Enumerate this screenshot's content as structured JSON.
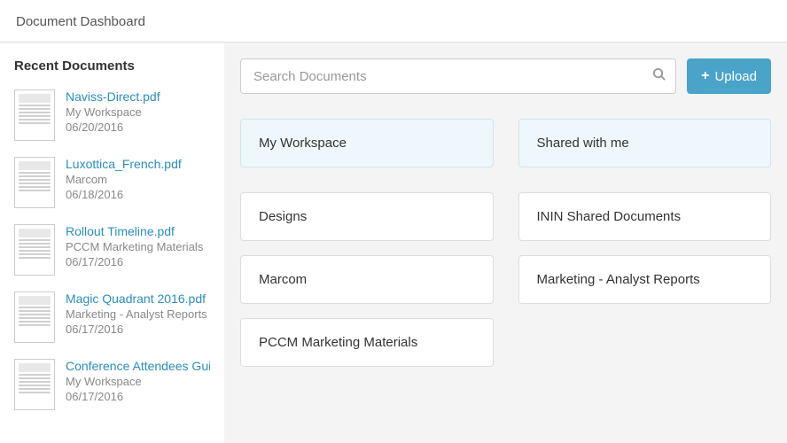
{
  "header": {
    "title": "Document Dashboard"
  },
  "sidebar": {
    "title": "Recent Documents",
    "docs": [
      {
        "title": "Naviss-Direct.pdf",
        "workspace": "My Workspace",
        "date": "06/20/2016"
      },
      {
        "title": "Luxottica_French.pdf",
        "workspace": "Marcom",
        "date": "06/18/2016"
      },
      {
        "title": "Rollout Timeline.pdf",
        "workspace": "PCCM Marketing Materials",
        "date": "06/17/2016"
      },
      {
        "title": "Magic Quadrant 2016.pdf",
        "workspace": "Marketing - Analyst Reports",
        "date": "06/17/2016"
      },
      {
        "title": "Conference Attendees Guide",
        "workspace": "My Workspace",
        "date": "06/17/2016"
      }
    ]
  },
  "search": {
    "placeholder": "Search Documents"
  },
  "upload": {
    "label": "Upload"
  },
  "top_folders": [
    {
      "label": "My Workspace"
    },
    {
      "label": "Shared with me"
    }
  ],
  "folders": [
    {
      "label": "Designs"
    },
    {
      "label": "ININ Shared Documents"
    },
    {
      "label": "Marcom"
    },
    {
      "label": "Marketing - Analyst Reports"
    },
    {
      "label": "PCCM Marketing Materials"
    }
  ]
}
